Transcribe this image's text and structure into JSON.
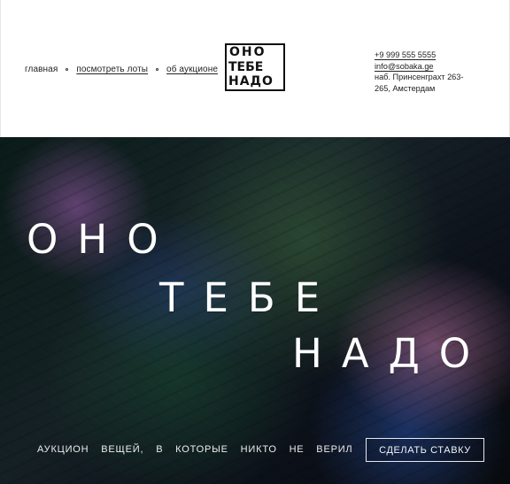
{
  "header": {
    "nav": {
      "items": [
        {
          "label": "главная"
        },
        {
          "label": "посмотреть лоты"
        },
        {
          "label": "об аукционе"
        }
      ]
    },
    "logo": {
      "lines": [
        "ОНО",
        "ТЕБЕ",
        "НАДО"
      ]
    },
    "contact": {
      "phone": "+9 999 555 5555",
      "email": "info@sobaka.ge",
      "address_line_1": "наб. Принсенграхт 263-",
      "address_line_2": "265, Амстердам"
    }
  },
  "hero": {
    "title": {
      "line1": "ОНО",
      "line2": "ТЕБЕ",
      "line3": "НАДО"
    },
    "tagline": "АУКЦИОН ВЕЩЕЙ, В КОТОРЫЕ НИКТО НЕ ВЕРИЛ",
    "cta_label": "СДЕЛАТЬ СТАВКУ"
  }
}
